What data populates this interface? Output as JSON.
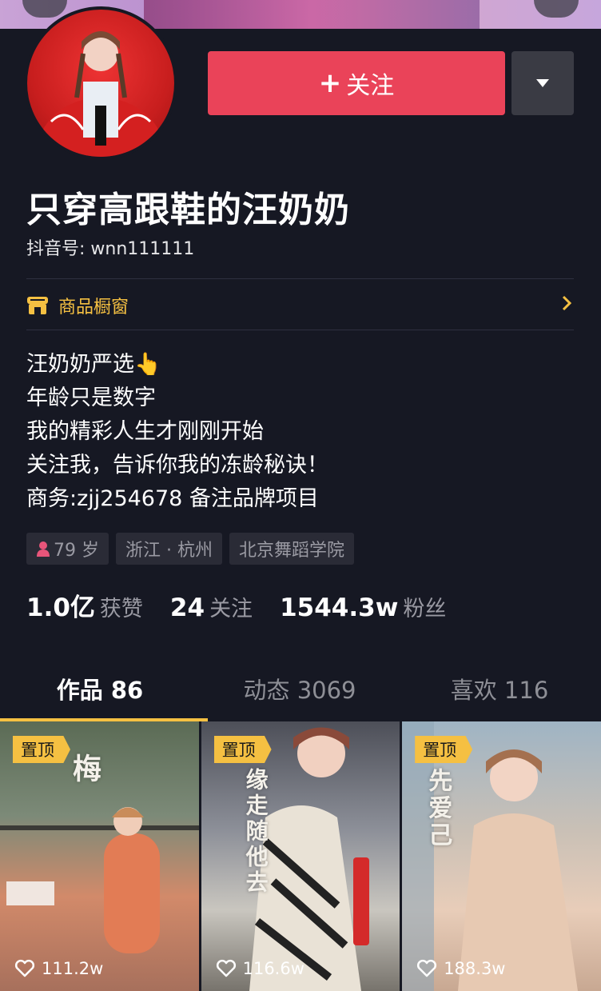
{
  "profile": {
    "display_name": "只穿高跟鞋的汪奶奶",
    "douyin_id": "抖音号: wnn111111",
    "follow_button": "关注"
  },
  "shop": {
    "label": "商品橱窗"
  },
  "bio": {
    "lines": [
      "汪奶奶严选👆",
      "年龄只是数字",
      "我的精彩人生才刚刚开始",
      "关注我，告诉你我的冻龄秘诀！",
      "商务:zjj254678 备注品牌项目"
    ]
  },
  "tags": {
    "age": "79 岁",
    "location": "浙江 · 杭州",
    "school": "北京舞蹈学院"
  },
  "stats": {
    "likes_num": "1.0亿",
    "likes_label": "获赞",
    "following_num": "24",
    "following_label": "关注",
    "fans_num": "1544.3w",
    "fans_label": "粉丝"
  },
  "tabs": [
    {
      "label": "作品 86"
    },
    {
      "label": "动态 3069"
    },
    {
      "label": "喜欢 116"
    }
  ],
  "videos": [
    {
      "pin": "置顶",
      "likes": "111.2w",
      "overlay_text": "梅"
    },
    {
      "pin": "置顶",
      "likes": "116.6w",
      "overlay_text": "缘走随他去"
    },
    {
      "pin": "置顶",
      "likes": "188.3w",
      "overlay_text": "先爱己"
    }
  ],
  "colors": {
    "background": "#161823",
    "accent_red": "#ea4359",
    "accent_yellow": "#f5c042"
  }
}
